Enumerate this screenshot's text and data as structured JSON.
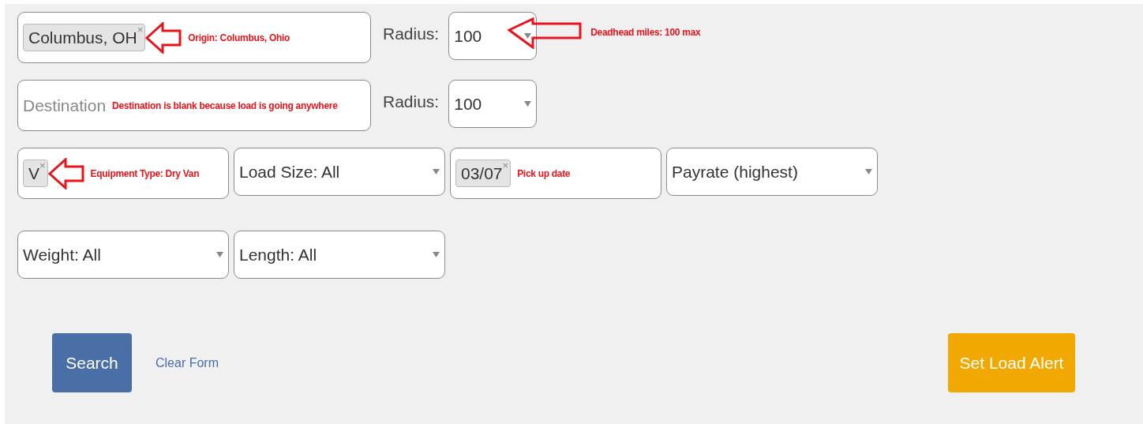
{
  "rows": [
    [
      {
        "kind": "tags",
        "tags": [
          {
            "label": "Columbus, OH",
            "remove": "×"
          }
        ],
        "annotation": "Origin: Columbus, Ohio",
        "arrow": true
      },
      {
        "kind": "label",
        "text": "Radius:"
      },
      {
        "kind": "select",
        "value": "100",
        "arrow": true
      },
      {
        "kind": "note",
        "text": "Deadhead miles:  100 max"
      }
    ],
    [
      {
        "kind": "text",
        "placeholder": "Destination",
        "annotation": "Destination is blank because load is going anywhere"
      },
      {
        "kind": "label",
        "text": "Radius:"
      },
      {
        "kind": "select",
        "value": "100"
      }
    ],
    [
      {
        "kind": "tags",
        "tags": [
          {
            "label": "V",
            "remove": "×"
          }
        ],
        "annotation": "Equipment Type:  Dry Van",
        "arrow": true
      },
      {
        "kind": "select",
        "value": "Load Size: All"
      },
      {
        "kind": "tags",
        "tags": [
          {
            "label": "03/07",
            "remove": "×"
          }
        ],
        "annotation": "Pick up date"
      },
      {
        "kind": "select",
        "value": "Payrate (highest)"
      }
    ],
    [
      {
        "kind": "select",
        "value": "Weight: All"
      },
      {
        "kind": "select",
        "value": "Length: All"
      }
    ]
  ],
  "buttons": [
    {
      "label": "Search",
      "kind": "primary"
    },
    {
      "label": "Clear Form",
      "kind": "link"
    },
    {
      "label": "Set Load Alert",
      "kind": "alert"
    }
  ]
}
